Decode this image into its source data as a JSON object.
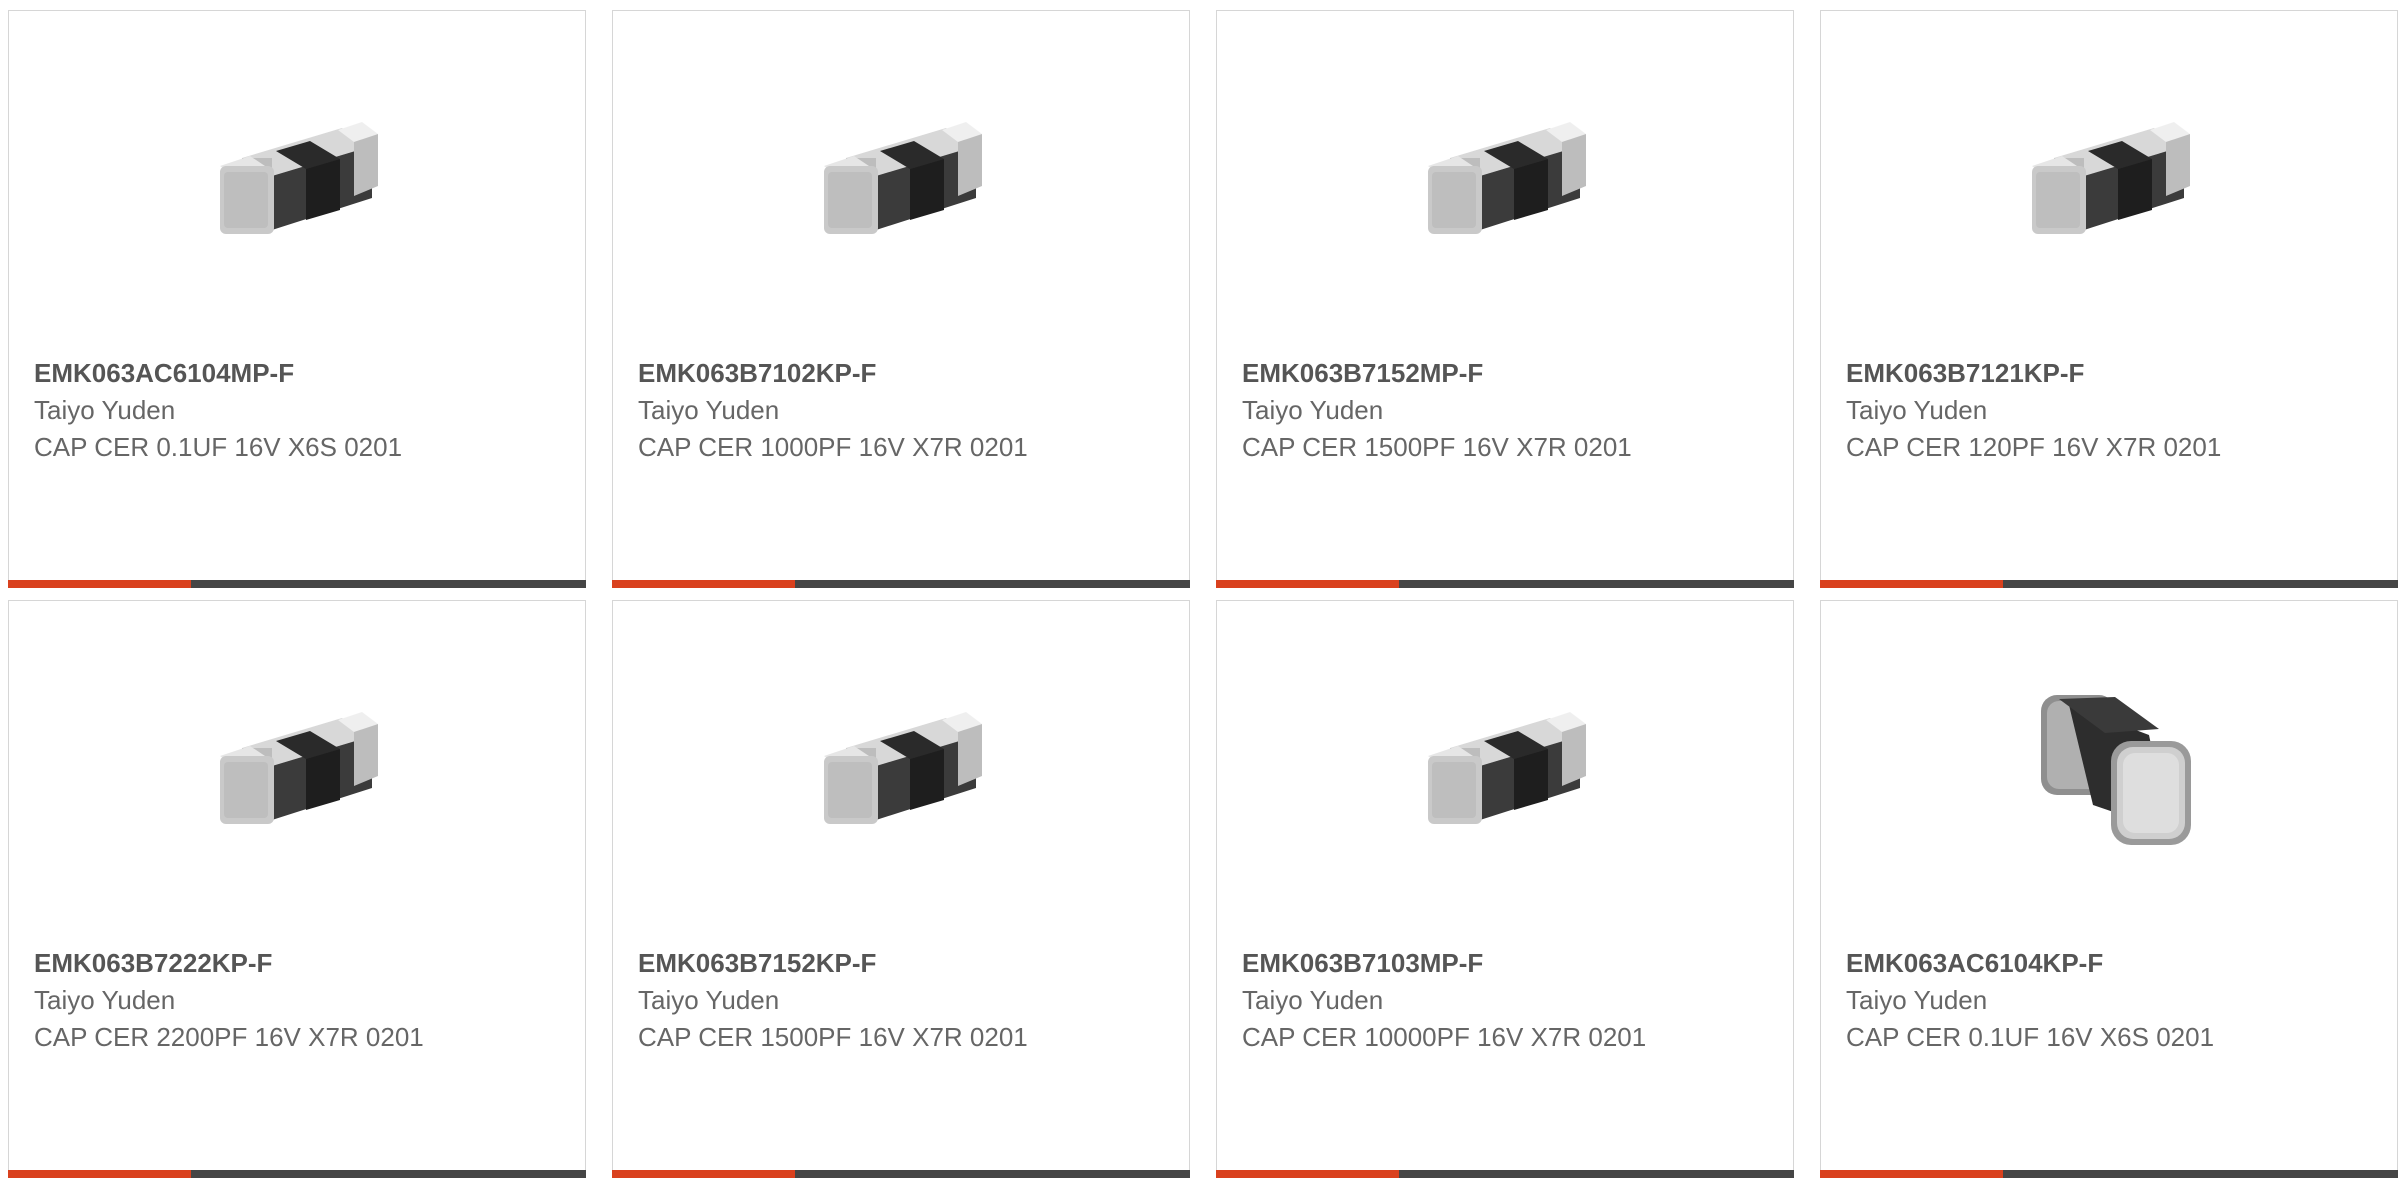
{
  "accent_color": "#d9411e",
  "bar_color": "#454545",
  "products": [
    {
      "part_number": "EMK063AC6104MP-F",
      "manufacturer": "Taiyo Yuden",
      "description": "CAP CER 0.1UF 16V X6S 0201",
      "image_icon": "chip-capacitor-icon"
    },
    {
      "part_number": "EMK063B7102KP-F",
      "manufacturer": "Taiyo Yuden",
      "description": "CAP CER 1000PF 16V X7R 0201",
      "image_icon": "chip-capacitor-icon"
    },
    {
      "part_number": "EMK063B7152MP-F",
      "manufacturer": "Taiyo Yuden",
      "description": "CAP CER 1500PF 16V X7R 0201",
      "image_icon": "chip-capacitor-icon"
    },
    {
      "part_number": "EMK063B7121KP-F",
      "manufacturer": "Taiyo Yuden",
      "description": "CAP CER 120PF 16V X7R 0201",
      "image_icon": "chip-capacitor-icon"
    },
    {
      "part_number": "EMK063B7222KP-F",
      "manufacturer": "Taiyo Yuden",
      "description": "CAP CER 2200PF 16V X7R 0201",
      "image_icon": "chip-capacitor-icon"
    },
    {
      "part_number": "EMK063B7152KP-F",
      "manufacturer": "Taiyo Yuden",
      "description": "CAP CER 1500PF 16V X7R 0201",
      "image_icon": "chip-capacitor-icon"
    },
    {
      "part_number": "EMK063B7103MP-F",
      "manufacturer": "Taiyo Yuden",
      "description": "CAP CER 10000PF 16V X7R 0201",
      "image_icon": "chip-capacitor-icon"
    },
    {
      "part_number": "EMK063AC6104KP-F",
      "manufacturer": "Taiyo Yuden",
      "description": "CAP CER 0.1UF 16V X6S 0201",
      "image_icon": "chip-capacitor-rounded-icon"
    }
  ]
}
